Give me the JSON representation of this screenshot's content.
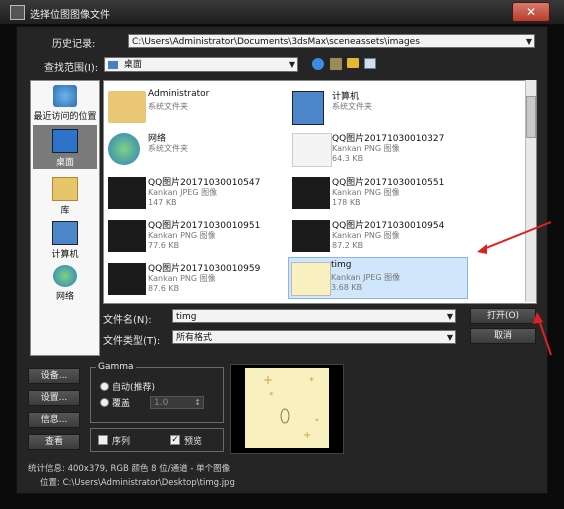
{
  "window": {
    "title": "选择位图图像文件",
    "close_label": "✕"
  },
  "history": {
    "label": "历史记录:",
    "value": "C:\\Users\\Administrator\\Documents\\3dsMax\\sceneassets\\images"
  },
  "lookin": {
    "label": "查找范围(I):",
    "value": "桌面"
  },
  "sidebar": {
    "items": [
      {
        "label": "最近访问的位置",
        "icon": "recent-places-icon"
      },
      {
        "label": "桌面",
        "icon": "desktop-icon",
        "selected": true
      },
      {
        "label": "库",
        "icon": "library-icon"
      },
      {
        "label": "计算机",
        "icon": "computer-icon"
      },
      {
        "label": "网络",
        "icon": "network-icon"
      }
    ]
  },
  "files": [
    {
      "name": "Administrator",
      "type": "系统文件夹",
      "size": "",
      "icon": "user-folder-icon"
    },
    {
      "name": "计算机",
      "type": "系统文件夹",
      "size": "",
      "icon": "computer-icon"
    },
    {
      "name": "网络",
      "type": "系统文件夹",
      "size": "",
      "icon": "network-icon"
    },
    {
      "name": "QQ图片20171030010327",
      "type": "Kankan PNG 图像",
      "size": "64.3 KB",
      "icon": "image-thumbnail-icon"
    },
    {
      "name": "QQ图片20171030010547",
      "type": "Kankan JPEG 图像",
      "size": "147 KB",
      "icon": "image-thumbnail-icon"
    },
    {
      "name": "QQ图片20171030010551",
      "type": "Kankan PNG 图像",
      "size": "178 KB",
      "icon": "image-thumbnail-icon"
    },
    {
      "name": "QQ图片20171030010951",
      "type": "Kankan PNG 图像",
      "size": "77.6 KB",
      "icon": "image-thumbnail-icon"
    },
    {
      "name": "QQ图片20171030010954",
      "type": "Kankan PNG 图像",
      "size": "87.2 KB",
      "icon": "image-thumbnail-icon"
    },
    {
      "name": "QQ图片20171030010959",
      "type": "Kankan PNG 图像",
      "size": "87.6 KB",
      "icon": "image-thumbnail-icon"
    },
    {
      "name": "timg",
      "type": "Kankan JPEG 图像",
      "size": "3.68 KB",
      "icon": "image-thumbnail-icon",
      "selected": true
    }
  ],
  "filename": {
    "label": "文件名(N):",
    "value": "timg"
  },
  "filetype": {
    "label": "文件类型(T):",
    "value": "所有格式"
  },
  "buttons": {
    "open": "打开(O)",
    "cancel": "取消",
    "setup": "设备...",
    "settings": "设置...",
    "info": "信息...",
    "view": "查看"
  },
  "gamma": {
    "title": "Gamma",
    "auto_label": "自动(推荐)",
    "override_label": "覆盖",
    "override_value": "1.0"
  },
  "options": {
    "sequence_label": "序列",
    "preview_label": "预览",
    "sequence_checked": false,
    "preview_checked": true
  },
  "status": {
    "stats": "统计信息: 400x379, RGB 颜色 8 位/通道 - 单个图像",
    "location": "位置: C:\\Users\\Administrator\\Desktop\\timg.jpg"
  },
  "colors": {
    "accent_selection": "#cfe6fb",
    "annotation_arrow": "#e02020",
    "preview_bg": "#f8f0bf"
  }
}
